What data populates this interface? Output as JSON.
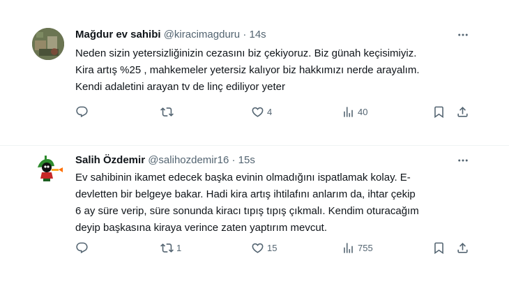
{
  "tweets": [
    {
      "name": "Mağdur ev sahibi",
      "handle": "@kiracimagduru",
      "separator": "·",
      "time": "14s",
      "text": "Neden sizin yetersizliğinizin cezasını biz çekiyoruz. Biz günah keçisimiyiz.\nKira artış %25 , mahkemeler yetersiz kalıyor biz hakkımızı nerde arayalım.\nKendi adaletini arayan tv de linç ediliyor yeter",
      "replies": "",
      "retweets": "",
      "likes": "4",
      "views": "40",
      "avatar_icon": "profile-photo"
    },
    {
      "name": "Salih Özdemir",
      "handle": "@salihozdemir16",
      "separator": "·",
      "time": "15s",
      "text": "Ev sahibinin ikamet edecek başka evinin olmadığını ispatlamak kolay. E-\ndevletten bir belgeye bakar. Hadi kira artış ihtilafını anlarım da, ihtar çekip\n6 ay süre verip, süre sonunda kiracı tıpış tıpış çıkmalı. Kendim oturacağım\ndeyip başkasına kiraya verince zaten yaptırım mevcut.",
      "replies": "",
      "retweets": "1",
      "likes": "15",
      "views": "755",
      "avatar_icon": "marvin-martian-avatar"
    }
  ],
  "icons": {
    "reply": "reply-icon",
    "retweet": "retweet-icon",
    "like": "heart-icon",
    "views": "views-icon",
    "bookmark": "bookmark-icon",
    "share": "share-icon",
    "more": "more-icon"
  },
  "colors": {
    "text": "#0f1419",
    "secondary": "#536471",
    "divider": "#eff3f4",
    "background": "#ffffff"
  }
}
